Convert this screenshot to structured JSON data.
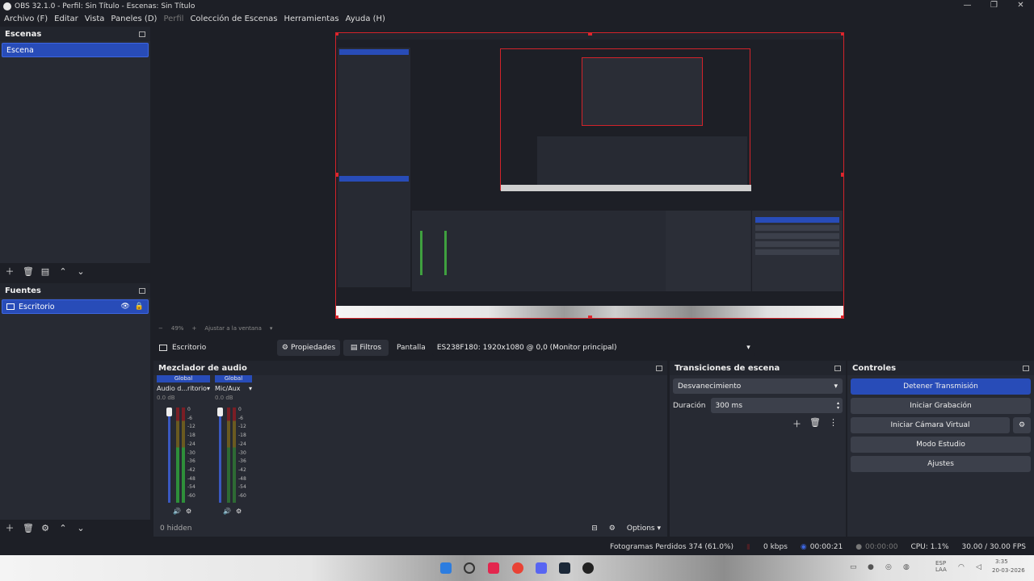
{
  "window": {
    "title": "OBS 32.1.0 - Perfil: Sin Título - Escenas: Sin Título",
    "minimize": "—",
    "maximize": "❐",
    "close": "✕"
  },
  "menu": [
    "Archivo (F)",
    "Editar",
    "Vista",
    "Paneles (D)",
    "Perfil",
    "Colección de Escenas",
    "Herramientas",
    "Ayuda (H)"
  ],
  "scenes": {
    "title": "Escenas",
    "items": [
      "Escena"
    ]
  },
  "sources": {
    "title": "Fuentes",
    "items": [
      "Escritorio"
    ]
  },
  "preview_toolbar": {
    "zoom": "49%",
    "fit": "Ajustar a la ventana"
  },
  "source_toolbar": {
    "source_name": "Escritorio",
    "properties": "Propiedades",
    "filters": "Filtros",
    "display_label": "Pantalla",
    "display_value": "ES238F180: 1920x1080 @ 0,0 (Monitor principal)"
  },
  "audio_mixer": {
    "title": "Mezclador de audio",
    "channels": [
      {
        "tag": "Global",
        "name": "Audio d...ritorio",
        "db": "0.0 dB"
      },
      {
        "tag": "Global",
        "name": "Mic/Aux",
        "db": "0.0 dB"
      }
    ],
    "scale": [
      "0",
      "-6",
      "-12",
      "-18",
      "-24",
      "-30",
      "-36",
      "-42",
      "-48",
      "-54",
      "-60"
    ],
    "hidden": "0 hidden",
    "options": "Options"
  },
  "transitions": {
    "title": "Transiciones de escena",
    "type": "Desvanecimiento",
    "duration_label": "Duración",
    "duration_value": "300 ms"
  },
  "controls": {
    "title": "Controles",
    "buttons": [
      "Detener Transmisión",
      "Iniciar Grabación",
      "Iniciar Cámara Virtual",
      "Modo Estudio",
      "Ajustes"
    ]
  },
  "status": {
    "dropped": "Fotogramas Perdidos 374 (61.0%)",
    "kbps": "0 kbps",
    "stream_time": "00:00:21",
    "rec_time": "00:00:00",
    "cpu": "CPU: 1.1%",
    "fps": "30.00 / 30.00 FPS"
  },
  "tray": {
    "lang": "ESP LAA",
    "time": "3:35",
    "date": "20-03-2026"
  },
  "colors": {
    "accent": "#284cb8",
    "preview_border": "#d2232a",
    "bg": "#1d1f26",
    "panel": "#272a33"
  }
}
